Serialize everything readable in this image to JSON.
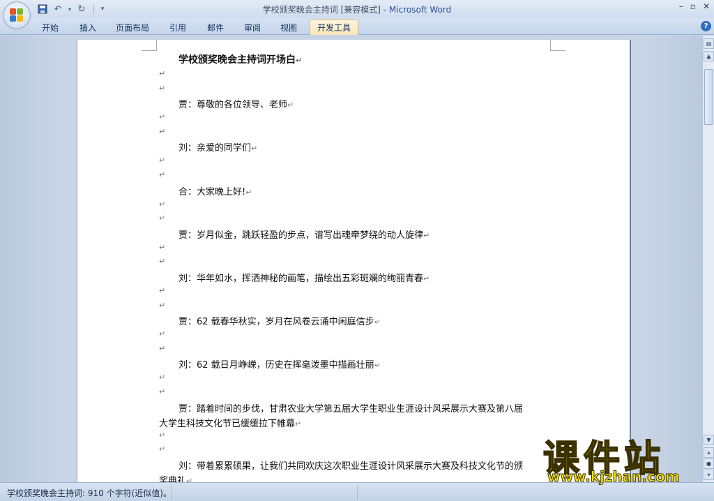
{
  "window": {
    "title_doc": "学校颁奖晚会主持词 [兼容模式] - ",
    "title_app": "Microsoft Word",
    "minimize": "–",
    "restore": "▫",
    "close": "✕"
  },
  "ribbon": {
    "tabs": [
      "开始",
      "插入",
      "页面布局",
      "引用",
      "邮件",
      "审阅",
      "视图",
      "开发工具"
    ],
    "active_tab": "开发工具"
  },
  "document": {
    "title": "学校颁奖晚会主持词开场白",
    "paragraph_mark": "↵",
    "lines": [
      {
        "type": "empty"
      },
      {
        "type": "empty"
      },
      {
        "type": "text",
        "text": "贾：尊敬的各位领导、老师"
      },
      {
        "type": "empty"
      },
      {
        "type": "empty"
      },
      {
        "type": "text",
        "text": "刘：亲爱的同学们"
      },
      {
        "type": "empty"
      },
      {
        "type": "empty"
      },
      {
        "type": "text",
        "text": "合：大家晚上好!"
      },
      {
        "type": "empty"
      },
      {
        "type": "empty"
      },
      {
        "type": "text",
        "text": "贾：岁月似金，跳跃轻盈的步点，谱写出魂牵梦绕的动人旋律"
      },
      {
        "type": "empty"
      },
      {
        "type": "empty"
      },
      {
        "type": "text",
        "text": "刘：华年如水，挥洒神秘的画笔，描绘出五彩斑斓的绚丽青春"
      },
      {
        "type": "empty"
      },
      {
        "type": "empty"
      },
      {
        "type": "text",
        "text": "贾：62 载春华秋实，岁月在风卷云涌中闲庭信步"
      },
      {
        "type": "empty"
      },
      {
        "type": "empty"
      },
      {
        "type": "text",
        "text": "刘：62 载日月峥嵘，历史在挥毫泼墨中描画壮丽"
      },
      {
        "type": "empty"
      },
      {
        "type": "empty"
      },
      {
        "type": "text",
        "text": "贾：踏着时间的步伐，甘肃农业大学第五届大学生职业生涯设计风采展示大赛及第八届"
      },
      {
        "type": "cont",
        "text": "大学生科技文化节已缓缓拉下帷幕"
      },
      {
        "type": "empty"
      },
      {
        "type": "empty"
      },
      {
        "type": "text",
        "text": "刘：带着累累硕果，让我们共同欢庆这次职业生涯设计风采展示大赛及科技文化节的颁"
      },
      {
        "type": "cont",
        "text": "奖典礼"
      }
    ]
  },
  "statusbar": {
    "text": "学校颁奖晚会主持词: 910 个字符(近似值)。"
  },
  "watermark": {
    "main": "课件站",
    "url": "www.kjzhan.com"
  }
}
